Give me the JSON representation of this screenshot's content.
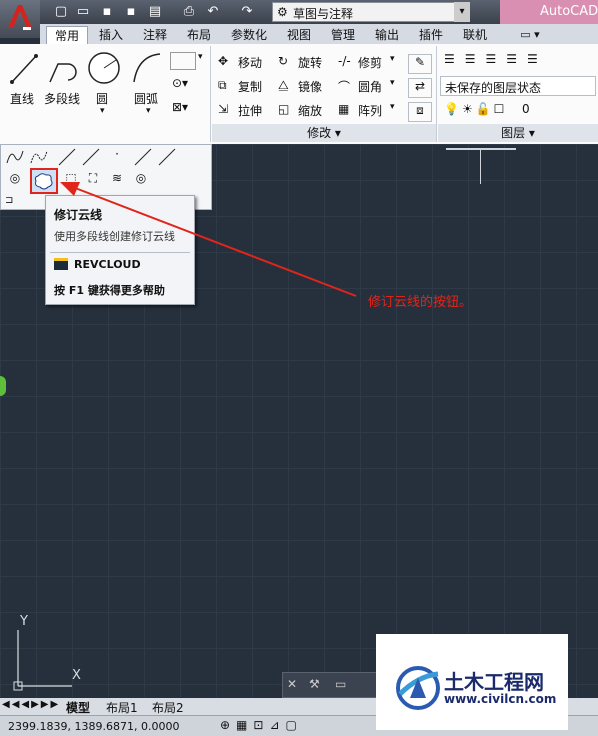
{
  "window": {
    "workspace": "草图与注释",
    "app_title": "AutoCAD"
  },
  "tabs": [
    "常用",
    "插入",
    "注释",
    "布局",
    "参数化",
    "视图",
    "管理",
    "输出",
    "插件",
    "联机"
  ],
  "draw_panel": {
    "line": "直线",
    "polyline": "多段线",
    "circle": "圆",
    "arc": "圆弧"
  },
  "modify_panel": {
    "title": "修改",
    "move": "移动",
    "rotate": "旋转",
    "trim": "修剪",
    "copy": "复制",
    "mirror": "镜像",
    "fillet": "圆角",
    "stretch": "拉伸",
    "scale": "缩放",
    "array": "阵列"
  },
  "layer_panel": {
    "title": "图层",
    "layer_state": "未保存的图层状态",
    "current_layer": "0"
  },
  "tooltip": {
    "title": "修订云线",
    "description": "使用多段线创建修订云线",
    "command": "REVCLOUD",
    "help": "按 F1 键获得更多帮助"
  },
  "annotation": "修订云线的按钮。",
  "ucs": {
    "y": "Y",
    "x": "X"
  },
  "layout_tabs": [
    "模型",
    "布局1",
    "布局2"
  ],
  "coordinates": "2399.1839, 1389.6871, 0.0000",
  "watermark": {
    "brand": "土木工程网",
    "url": "www.civilcn.com"
  },
  "colors": {
    "canvas": "#26303d",
    "annotation_red": "#e0251b",
    "highlight_red": "#e0251b"
  }
}
